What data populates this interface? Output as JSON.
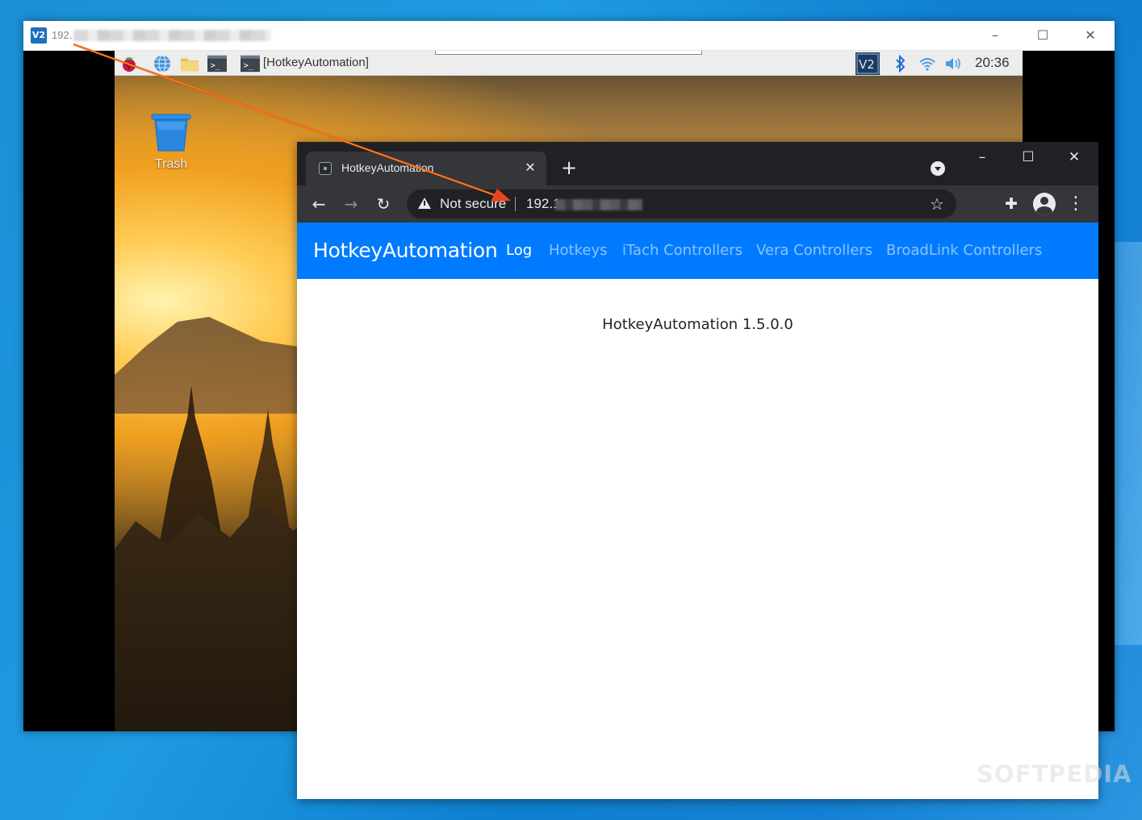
{
  "vnc_viewer": {
    "logo_text": "V2",
    "title": "192.",
    "controls": {
      "minimize": "–",
      "maximize": "☐",
      "close": "✕"
    }
  },
  "pi_desktop": {
    "taskbar": {
      "icons": [
        "raspberry-icon",
        "web-browser-icon",
        "file-manager-icon",
        "terminal-icon",
        "terminal-window-icon"
      ],
      "active_window_label": "[HotkeyAutomation]",
      "tray_icons": [
        "vnc-icon",
        "bluetooth-icon",
        "wifi-icon",
        "volume-icon"
      ],
      "clock": "20:36"
    },
    "trash_label": "Trash"
  },
  "browser": {
    "tab_title": "HotkeyAutomation",
    "new_tab": "+",
    "close_tab": "✕",
    "window_controls": {
      "minimize": "–",
      "maximize": "☐",
      "close": "✕"
    },
    "toolbar": {
      "back": "←",
      "forward": "→",
      "reload": "↻"
    },
    "address": {
      "security_label": "Not secure",
      "url": "192.1"
    },
    "bookmark": "☆",
    "extensions": "✚",
    "menu": "⋮"
  },
  "page": {
    "brand": "HotkeyAutomation",
    "nav": [
      {
        "label": "Log",
        "active": true
      },
      {
        "label": "Hotkeys",
        "active": false
      },
      {
        "label": "iTach Controllers",
        "active": false
      },
      {
        "label": "Vera Controllers",
        "active": false
      },
      {
        "label": "BroadLink Controllers",
        "active": false
      }
    ],
    "version_text": "HotkeyAutomation 1.5.0.0"
  },
  "watermark": "SOFTPEDIA",
  "colors": {
    "navbar": "#007bff",
    "chrome_dark": "#202124",
    "chrome_toolbar": "#35363a",
    "annotation_arrow": "#e8451e"
  }
}
